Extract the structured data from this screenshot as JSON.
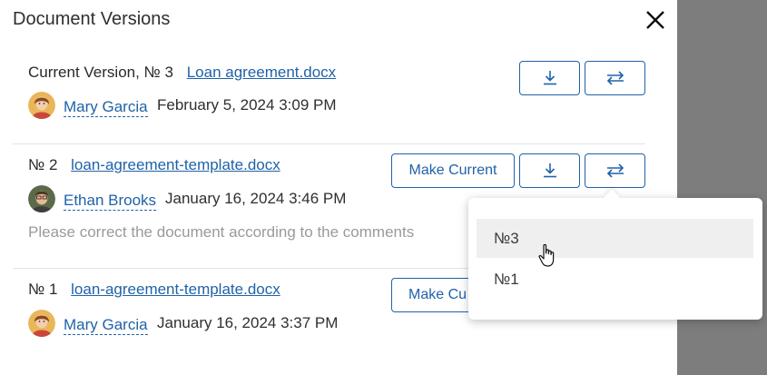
{
  "dialog": {
    "title": "Document Versions",
    "close_icon": "close-icon"
  },
  "versions": [
    {
      "label": "Current Version, № 3",
      "file": "Loan agreement.docx",
      "author": "Mary Garcia",
      "date": "February 5, 2024 3:09 PM",
      "comment": ""
    },
    {
      "label": "№ 2",
      "file": "loan-agreement-template.docx",
      "author": "Ethan Brooks",
      "date": "January 16, 2024 3:46 PM",
      "comment": "Please correct the document according to the comments",
      "make_current_label": "Make Current"
    },
    {
      "label": "№ 1",
      "file": "loan-agreement-template.docx",
      "author": "Mary Garcia",
      "date": "January 16, 2024 3:37 PM",
      "comment": "",
      "make_current_label": "Make Cu"
    }
  ],
  "compare_dropdown": {
    "items": [
      "№3",
      "№1"
    ],
    "hovered_index": 0
  },
  "colors": {
    "link": "#1f62a8",
    "overlay": "#7d7d7d",
    "muted_text": "#9a9a9a"
  }
}
